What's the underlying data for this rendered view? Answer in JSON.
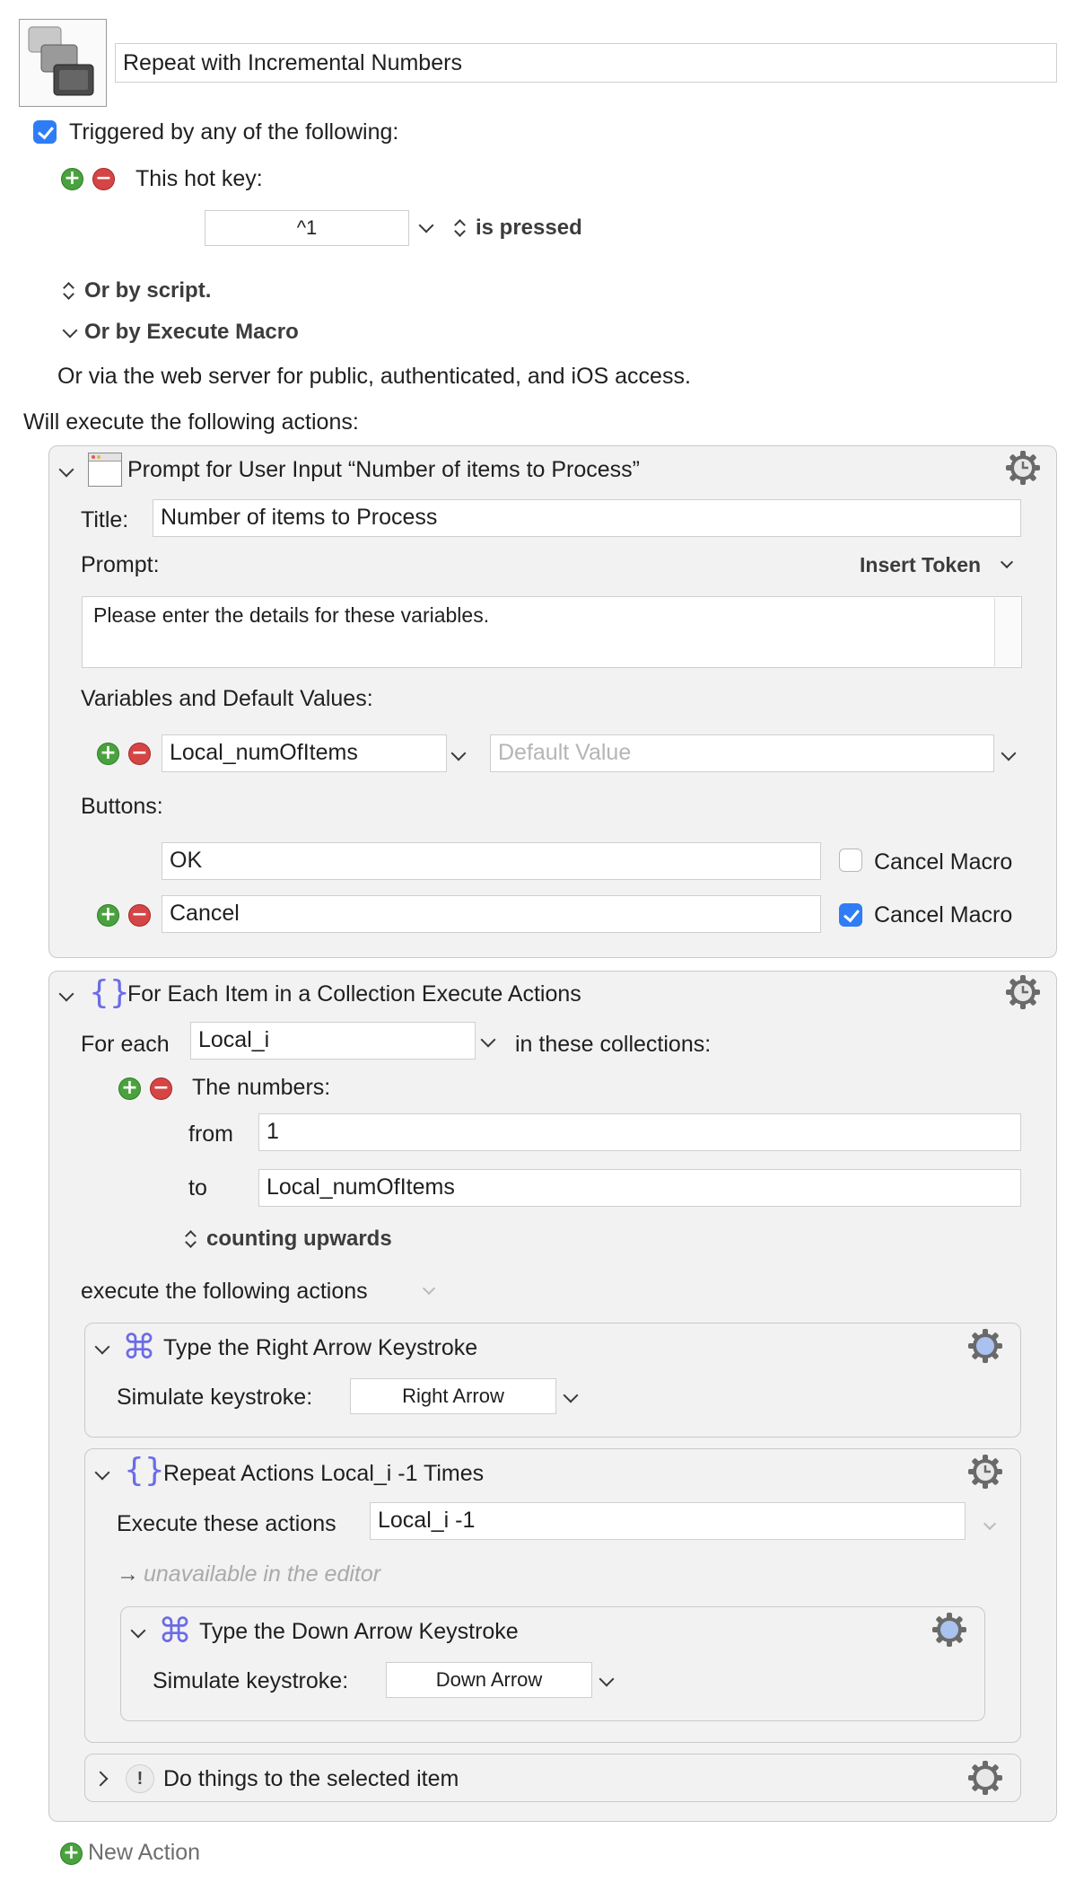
{
  "macro": {
    "name": "Repeat with Incremental Numbers",
    "icon": "macro-group-icon"
  },
  "triggers": {
    "enabled": true,
    "label": "Triggered by any of the following:",
    "hotkey_label": "This hot key:",
    "hotkey_value": "^1",
    "hotkey_state": "is pressed",
    "or_script": "Or by script.",
    "or_execute": "Or by Execute Macro",
    "web_server": "Or via the web server for public, authenticated, and iOS access."
  },
  "actions_header": "Will execute the following actions:",
  "prompt_action": {
    "title": "Prompt for User Input “Number of items to Process”",
    "title_label": "Title:",
    "title_value": "Number of items to Process",
    "prompt_label": "Prompt:",
    "insert_token": "Insert Token",
    "prompt_text": "Please enter the details for these variables.",
    "variables_label": "Variables and Default Values:",
    "variable_name": "Local_numOfItems",
    "default_placeholder": "Default Value",
    "buttons_label": "Buttons:",
    "buttons": [
      {
        "label": "OK",
        "cancel_label": "Cancel Macro",
        "cancel": false
      },
      {
        "label": "Cancel",
        "cancel_label": "Cancel Macro",
        "cancel": true
      }
    ]
  },
  "foreach_action": {
    "title": "For Each Item in a Collection Execute Actions",
    "for_each_label": "For each",
    "variable": "Local_i",
    "in_collections": "in these collections:",
    "collection_label": "The numbers:",
    "from_label": "from",
    "from_value": "1",
    "to_label": "to",
    "to_value": "Local_numOfItems",
    "direction": "counting upwards",
    "execute_label": "execute the following actions"
  },
  "type_right": {
    "title": "Type the Right Arrow Keystroke",
    "simulate_label": "Simulate keystroke:",
    "key": "Right Arrow"
  },
  "repeat_action": {
    "title": "Repeat Actions Local_i -1  Times",
    "execute_label": "Execute these actions",
    "count_value": "Local_i -1",
    "unavailable": "unavailable in the editor"
  },
  "type_down": {
    "title": "Type the Down Arrow Keystroke",
    "simulate_label": "Simulate keystroke:",
    "key": "Down Arrow"
  },
  "collapsed_action": {
    "title": "Do things to the selected item"
  },
  "new_action": "New Action",
  "colors": {
    "accent": "#2f7df6",
    "glyph": "#6b6ce6",
    "panel": "#f2f2f2",
    "add": "#4aa23f",
    "remove": "#d64545"
  }
}
